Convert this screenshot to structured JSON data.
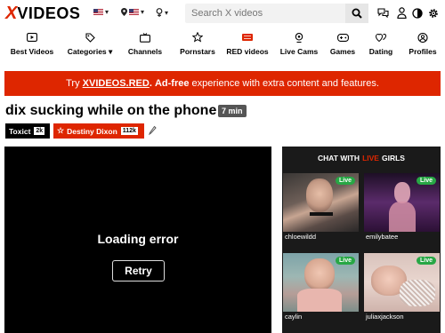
{
  "header": {
    "logo_x": "X",
    "logo_rest": "VIDEOS",
    "search_placeholder": "Search X videos",
    "icons": [
      "chat-icon",
      "user-icon",
      "contrast-icon",
      "gear-icon"
    ]
  },
  "nav": [
    {
      "label": "Best Videos",
      "icon": "play-icon"
    },
    {
      "label": "Categories ▾",
      "icon": "tag-icon"
    },
    {
      "label": "Channels",
      "icon": "tv-icon"
    },
    {
      "label": "Pornstars",
      "icon": "star-icon"
    },
    {
      "label": "RED videos",
      "icon": "red-logo-icon"
    },
    {
      "label": "Live Cams",
      "icon": "webcam-icon"
    },
    {
      "label": "Games",
      "icon": "gamepad-icon"
    },
    {
      "label": "Dating",
      "icon": "hearts-icon"
    },
    {
      "label": "Profiles",
      "icon": "profiles-icon"
    }
  ],
  "banner": {
    "pre": "Try ",
    "link": "XVIDEOS.RED",
    "dot": ". ",
    "bold": "Ad-free",
    "post": " experience with extra content and features."
  },
  "video": {
    "title": "dix sucking while on the phone",
    "duration": "7 min",
    "uploader": "Toxict",
    "uploader_count": "2k",
    "model": "Destiny Dixon",
    "model_count": "112k"
  },
  "player": {
    "error_text": "Loading error",
    "retry_label": "Retry"
  },
  "live": {
    "head_pre": "CHAT WITH",
    "head_red": "LIVE",
    "head_post": "GIRLS",
    "badge": "Live",
    "cams": [
      {
        "name": "chloewildd"
      },
      {
        "name": "emilybatee"
      },
      {
        "name": "caylin"
      },
      {
        "name": "juliaxjackson"
      }
    ]
  },
  "colors": {
    "brand_red": "#de2600",
    "live_green": "#28a745"
  }
}
